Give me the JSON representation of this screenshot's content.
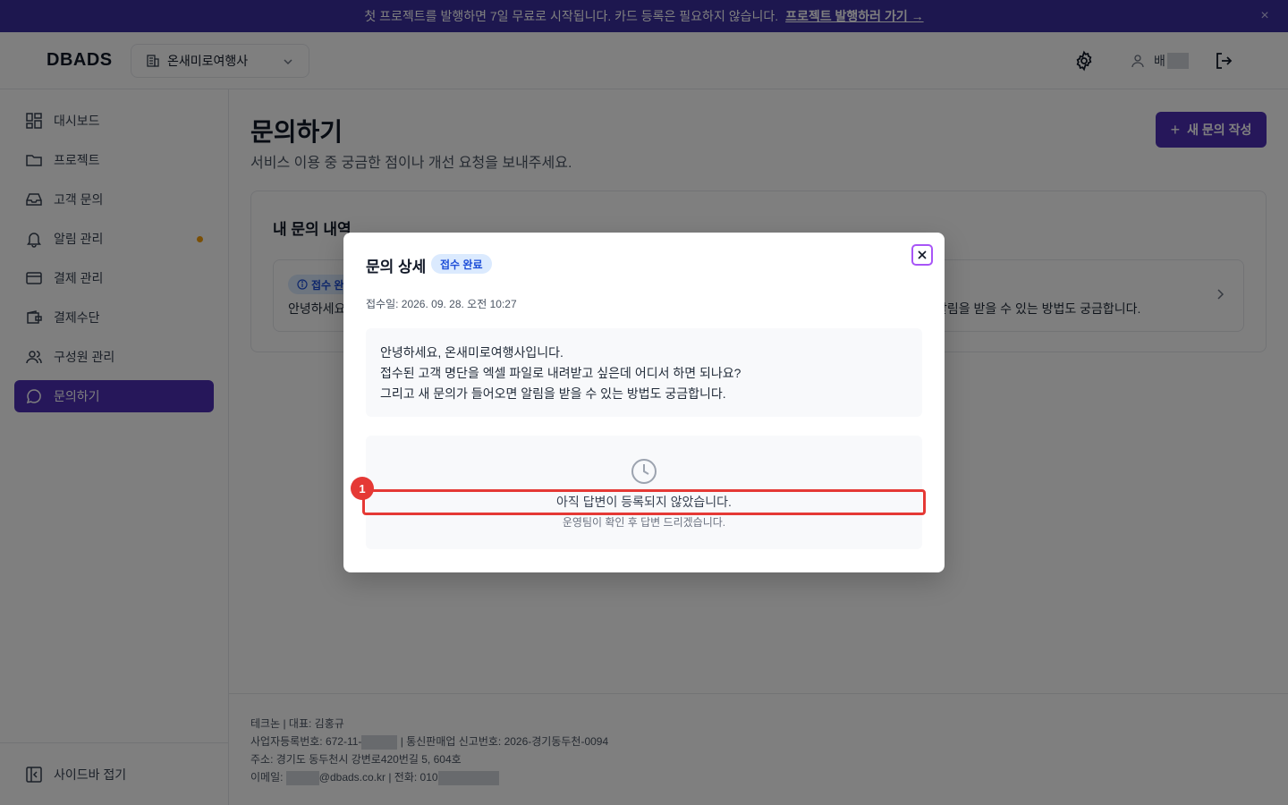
{
  "banner": {
    "text": "첫 프로젝트를 발행하면 7일 무료로 시작됩니다. 카드 등록은 필요하지 않습니다.",
    "link": "프로젝트 발행하러 가기 →",
    "close": "×"
  },
  "header": {
    "logo": "DBADS",
    "org_name": "온새미로여행사",
    "user_name": "배"
  },
  "sidebar": {
    "items": [
      {
        "label": "대시보드",
        "icon": "dashboard-icon"
      },
      {
        "label": "프로젝트",
        "icon": "folder-icon"
      },
      {
        "label": "고객 문의",
        "icon": "inbox-icon"
      },
      {
        "label": "알림 관리",
        "icon": "bell-icon"
      },
      {
        "label": "결제 관리",
        "icon": "credit-card-icon"
      },
      {
        "label": "결제수단",
        "icon": "wallet-icon"
      },
      {
        "label": "구성원 관리",
        "icon": "users-icon"
      },
      {
        "label": "문의하기",
        "icon": "chat-icon"
      }
    ],
    "active": "문의하기",
    "collapse_label": "사이드바 접기"
  },
  "page": {
    "title": "문의하기",
    "subtitle": "서비스 이용 중 궁금한 점이나 개선 요청을 보내주세요.",
    "new_button": "새 문의 작성",
    "history_title": "내 문의 내역",
    "item": {
      "badge": "접수 완료",
      "preview_start": "안녕하세요",
      "preview_end": "알림을 받을 수 있는 방법도 궁금합니다."
    }
  },
  "footer": {
    "company": "테크논 | 대표: 김홍규",
    "biz_no_prefix": "사업자등록번호: 672-11-",
    "biz_no_suffix": " | 통신판매업 신고번호: 2026-경기동두천-0094",
    "address": "주소: 경기도 동두천시 강변로420번길 5, 604호",
    "email_prefix": "이메일: ",
    "email_domain": "@dbads.co.kr",
    "phone_prefix": " | 전화: 010"
  },
  "modal": {
    "title": "문의 상세",
    "badge": "접수 완료",
    "date": "접수일: 2026. 09. 28. 오전 10:27",
    "message": [
      "안녕하세요, 온새미로여행사입니다.",
      "접수된 고객 명단을 엑셀 파일로 내려받고 싶은데 어디서 하면 되나요?",
      "그리고 새 문의가 들어오면 알림을 받을 수 있는 방법도 궁금합니다."
    ],
    "no_answer_title": "아직 답변이 등록되지 않았습니다.",
    "no_answer_sub": "운영팀이 확인 후 답변 드리겠습니다."
  },
  "annotation": {
    "badge": "1",
    "color": "#e53935"
  },
  "colors": {
    "brand": "#4c2fb5",
    "banner": "#3b2e9e",
    "badge_bg": "#dbeafe",
    "badge_text": "#1d4ed8"
  }
}
